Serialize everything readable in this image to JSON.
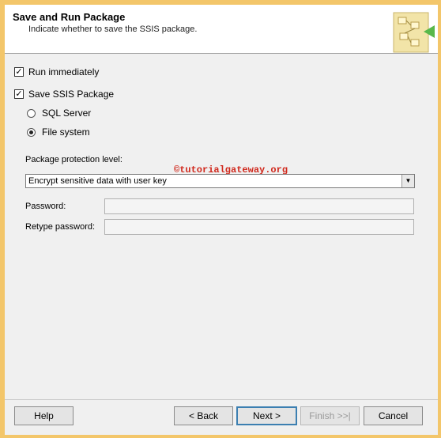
{
  "header": {
    "title": "Save and Run Package",
    "subtitle": "Indicate whether to save the SSIS package."
  },
  "options": {
    "run_immediately": {
      "label": "Run immediately",
      "checked": true
    },
    "save_package": {
      "label": "Save SSIS Package",
      "checked": true
    },
    "sql_server": {
      "label": "SQL Server",
      "selected": false
    },
    "file_system": {
      "label": "File system",
      "selected": true
    }
  },
  "protection": {
    "label": "Package protection level:",
    "selected_value": "Encrypt sensitive data with user key"
  },
  "password": {
    "label": "Password:",
    "value": ""
  },
  "retype_password": {
    "label": "Retype password:",
    "value": ""
  },
  "watermark": "©tutorialgateway.org",
  "buttons": {
    "help": "Help",
    "back": "< Back",
    "next": "Next >",
    "finish": "Finish >>|",
    "cancel": "Cancel"
  },
  "colors": {
    "frame": "#f3c66a",
    "watermark": "#d0281c",
    "default_button_border": "#3c7fb1"
  }
}
